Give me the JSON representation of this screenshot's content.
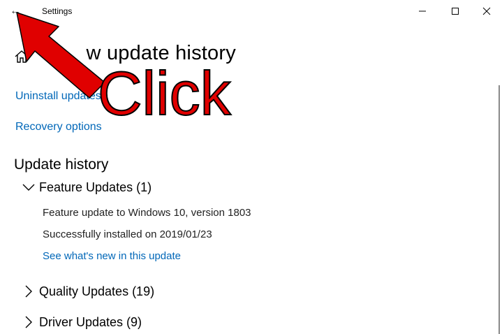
{
  "window": {
    "title": "Settings",
    "back_icon": "back-arrow-icon",
    "controls": [
      "minimize-icon",
      "maximize-icon",
      "close-icon"
    ]
  },
  "page": {
    "title": "View update history",
    "title_visible_parts": [
      "V",
      "w update history"
    ],
    "home_icon": "home-icon"
  },
  "links": {
    "uninstall": "Uninstall updates",
    "recovery": "Recovery options"
  },
  "history": {
    "heading": "Update history",
    "groups": [
      {
        "label": "Feature Updates (1)",
        "expanded": true,
        "items": [
          {
            "name": "Feature update to Windows 10, version 1803",
            "status": "Successfully installed on 2019/01/23",
            "link": "See what's new in this update"
          }
        ]
      },
      {
        "label": "Quality Updates (19)",
        "expanded": false
      },
      {
        "label": "Driver Updates (9)",
        "expanded": false
      }
    ]
  },
  "annotation": {
    "text": "Click",
    "color": "#e00000",
    "arrow_color": "#e00000"
  },
  "colors": {
    "link": "#0067b8",
    "background": "#ffffff"
  }
}
